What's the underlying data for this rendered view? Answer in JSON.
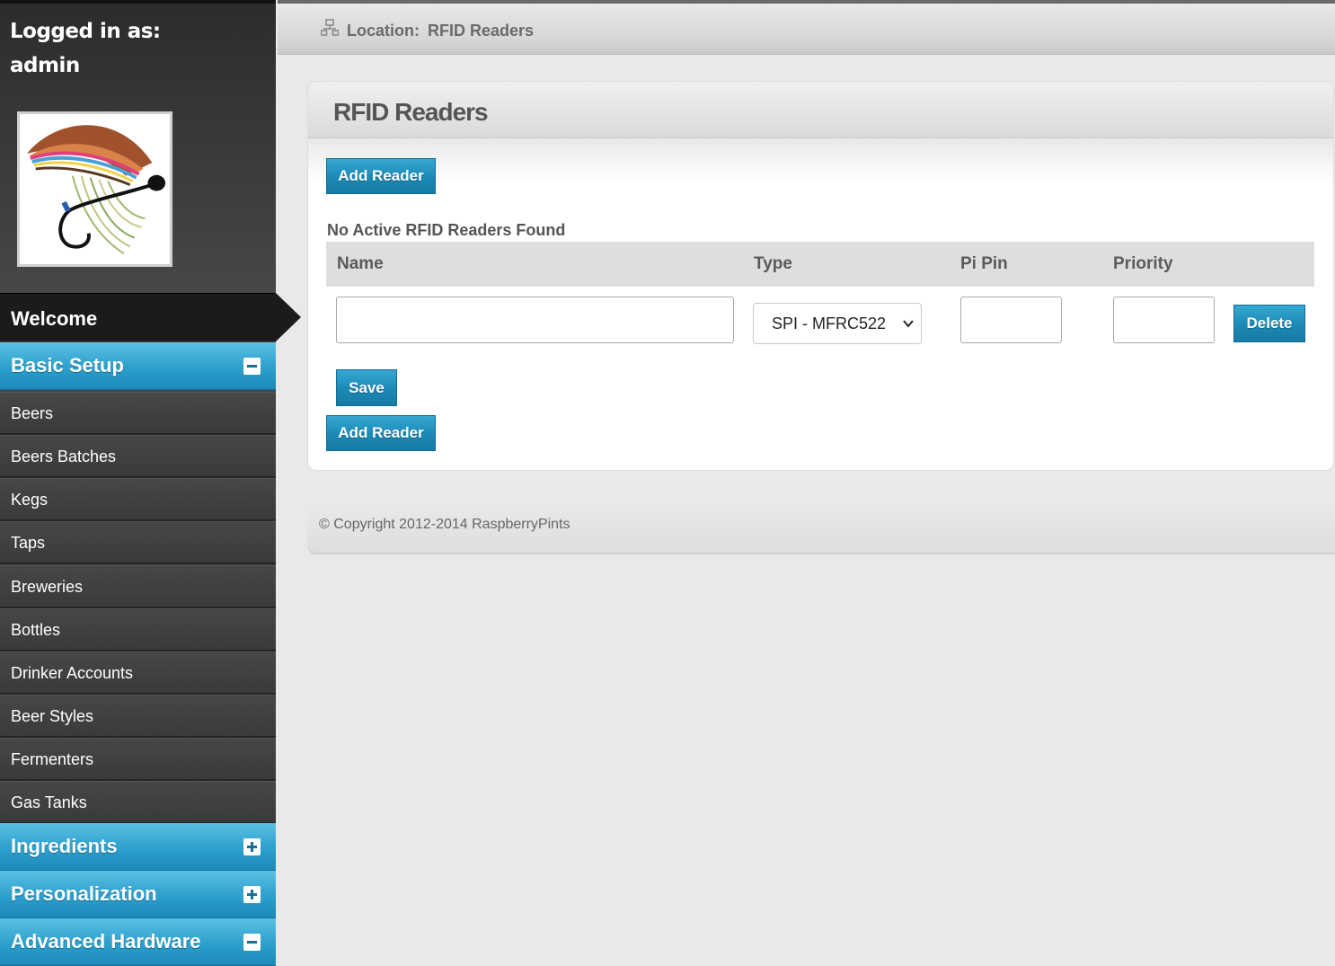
{
  "sidebar": {
    "login_line1": "Logged in as:",
    "login_line2": "admin",
    "avatar_icon": "fishing-fly-icon",
    "welcome": "Welcome",
    "sections": [
      {
        "label": "Basic Setup",
        "state": "expanded"
      },
      {
        "label": "Ingredients",
        "state": "collapsed"
      },
      {
        "label": "Personalization",
        "state": "collapsed"
      },
      {
        "label": "Advanced Hardware",
        "state": "expanded"
      }
    ],
    "items": [
      "Beers",
      "Beers Batches",
      "Kegs",
      "Taps",
      "Breweries",
      "Bottles",
      "Drinker Accounts",
      "Beer Styles",
      "Fermenters",
      "Gas Tanks"
    ]
  },
  "location": {
    "icon": "sitemap-icon",
    "label": "Location:",
    "value": "RFID Readers"
  },
  "panel": {
    "title": "RFID Readers",
    "add_reader": "Add Reader",
    "status": "No Active RFID Readers Found",
    "columns": [
      "Name",
      "Type",
      "Pi Pin",
      "Priority"
    ],
    "row": {
      "name": "",
      "type": "SPI - MFRC522",
      "pin": "",
      "priority": "",
      "delete": "Delete"
    },
    "save": "Save"
  },
  "footer": {
    "copyright": "© Copyright 2012-2014 RaspberryPints"
  },
  "colors": {
    "accent": "#1d8bb8",
    "sidebar_bg": "#3d3d3d",
    "page_bg": "#e9e9e9"
  }
}
